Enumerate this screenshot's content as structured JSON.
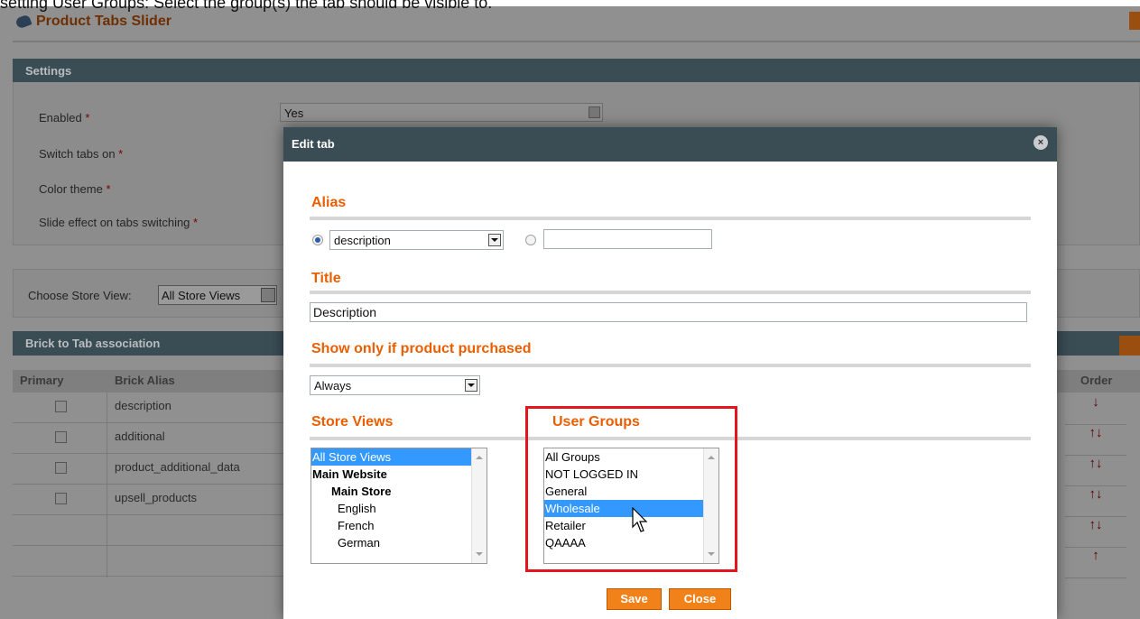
{
  "caption": "setting User Groups: Select the group(s) the tab should be visible to.",
  "header": {
    "title": "Product Tabs Slider"
  },
  "settings": {
    "title": "Settings",
    "fields": [
      {
        "label": "Enabled",
        "value": "Yes"
      },
      {
        "label": "Switch tabs on"
      },
      {
        "label": "Color theme"
      },
      {
        "label": "Slide effect on tabs switching"
      }
    ],
    "required_mark": "*"
  },
  "store_view": {
    "label": "Choose Store View:",
    "value": "All Store Views"
  },
  "grid": {
    "title": "Brick to Tab association",
    "columns": {
      "primary": "Primary",
      "alias": "Brick Alias",
      "order": "Order"
    },
    "rows": [
      "description",
      "additional",
      "product_additional_data",
      "upsell_products"
    ],
    "order_arrows": [
      "↓",
      "↑↓",
      "↑↓",
      "↑↓",
      "↑↓",
      "↑"
    ]
  },
  "modal": {
    "title": "Edit tab",
    "alias": {
      "heading": "Alias",
      "selected": "description",
      "custom_value": ""
    },
    "title_section": {
      "heading": "Title",
      "value": "Description"
    },
    "purchased": {
      "heading": "Show only if product purchased",
      "value": "Always"
    },
    "store_views": {
      "heading": "Store Views",
      "options": [
        {
          "label": "All Store Views",
          "selected": true,
          "bold": false,
          "indent": 0
        },
        {
          "label": "Main Website",
          "selected": false,
          "bold": true,
          "indent": 0
        },
        {
          "label": "Main Store",
          "selected": false,
          "bold": true,
          "indent": 1
        },
        {
          "label": "English",
          "selected": false,
          "bold": false,
          "indent": 2
        },
        {
          "label": "French",
          "selected": false,
          "bold": false,
          "indent": 2
        },
        {
          "label": "German",
          "selected": false,
          "bold": false,
          "indent": 2
        }
      ]
    },
    "user_groups": {
      "heading": "User Groups",
      "options": [
        {
          "label": "All Groups",
          "selected": false
        },
        {
          "label": "NOT LOGGED IN",
          "selected": false
        },
        {
          "label": "General",
          "selected": false
        },
        {
          "label": "Wholesale",
          "selected": true
        },
        {
          "label": "Retailer",
          "selected": false
        },
        {
          "label": "QAAAA",
          "selected": false
        }
      ]
    },
    "buttons": {
      "save": "Save",
      "close": "Close"
    },
    "close_icon": "×"
  },
  "colors": {
    "accent": "#eb5e00",
    "button": "#f18119",
    "highlight": "#e3161d",
    "header": "#3a4c54"
  }
}
